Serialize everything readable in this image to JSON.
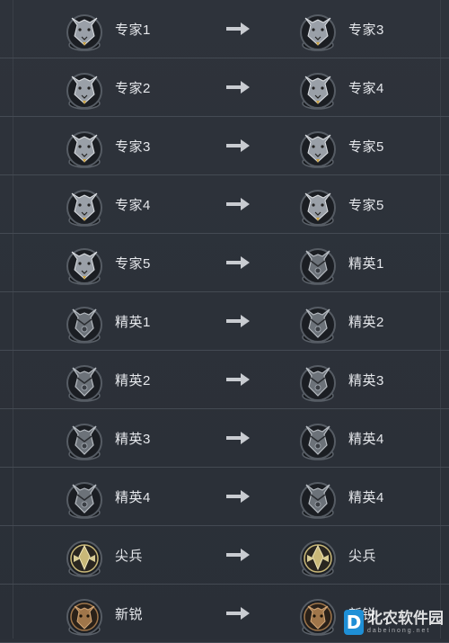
{
  "rows": [
    {
      "from": {
        "label": "专家1",
        "icon": "wolf-expert-icon"
      },
      "to": {
        "label": "专家3",
        "icon": "wolf-expert-icon"
      }
    },
    {
      "from": {
        "label": "专家2",
        "icon": "wolf-expert-icon"
      },
      "to": {
        "label": "专家4",
        "icon": "wolf-expert-icon"
      }
    },
    {
      "from": {
        "label": "专家3",
        "icon": "wolf-expert-icon"
      },
      "to": {
        "label": "专家5",
        "icon": "wolf-expert-icon"
      }
    },
    {
      "from": {
        "label": "专家4",
        "icon": "wolf-expert-icon"
      },
      "to": {
        "label": "专家5",
        "icon": "wolf-expert-icon"
      }
    },
    {
      "from": {
        "label": "专家5",
        "icon": "wolf-expert-icon"
      },
      "to": {
        "label": "精英1",
        "icon": "wolf-elite-icon"
      }
    },
    {
      "from": {
        "label": "精英1",
        "icon": "wolf-elite-icon"
      },
      "to": {
        "label": "精英2",
        "icon": "wolf-elite-icon"
      }
    },
    {
      "from": {
        "label": "精英2",
        "icon": "wolf-elite-icon"
      },
      "to": {
        "label": "精英3",
        "icon": "wolf-elite-icon"
      }
    },
    {
      "from": {
        "label": "精英3",
        "icon": "wolf-elite-icon"
      },
      "to": {
        "label": "精英4",
        "icon": "wolf-elite-icon"
      }
    },
    {
      "from": {
        "label": "精英4",
        "icon": "wolf-elite-icon"
      },
      "to": {
        "label": "精英4",
        "icon": "wolf-elite-icon"
      }
    },
    {
      "from": {
        "label": "尖兵",
        "icon": "eagle-vanguard-icon"
      },
      "to": {
        "label": "尖兵",
        "icon": "eagle-vanguard-icon"
      }
    },
    {
      "from": {
        "label": "新锐",
        "icon": "tiger-rookie-icon"
      },
      "to": {
        "label": "新锐",
        "icon": "tiger-rookie-icon"
      }
    }
  ],
  "arrow_icon": "right-arrow-icon",
  "watermark": {
    "logo": "D",
    "main": "北农软件园",
    "sub": "dabeinong.net"
  },
  "colors": {
    "background": "#2b3038",
    "row_divider": "#444a53",
    "text": "#e6e8ec",
    "arrow": "#c9ccd1",
    "expert_fur": "#9aa0a8",
    "elite_metal": "#6c7279",
    "vanguard_gold": "#c9b878",
    "rookie_bronze": "#a0764a",
    "watermark_blue": "#1e8fd6"
  }
}
